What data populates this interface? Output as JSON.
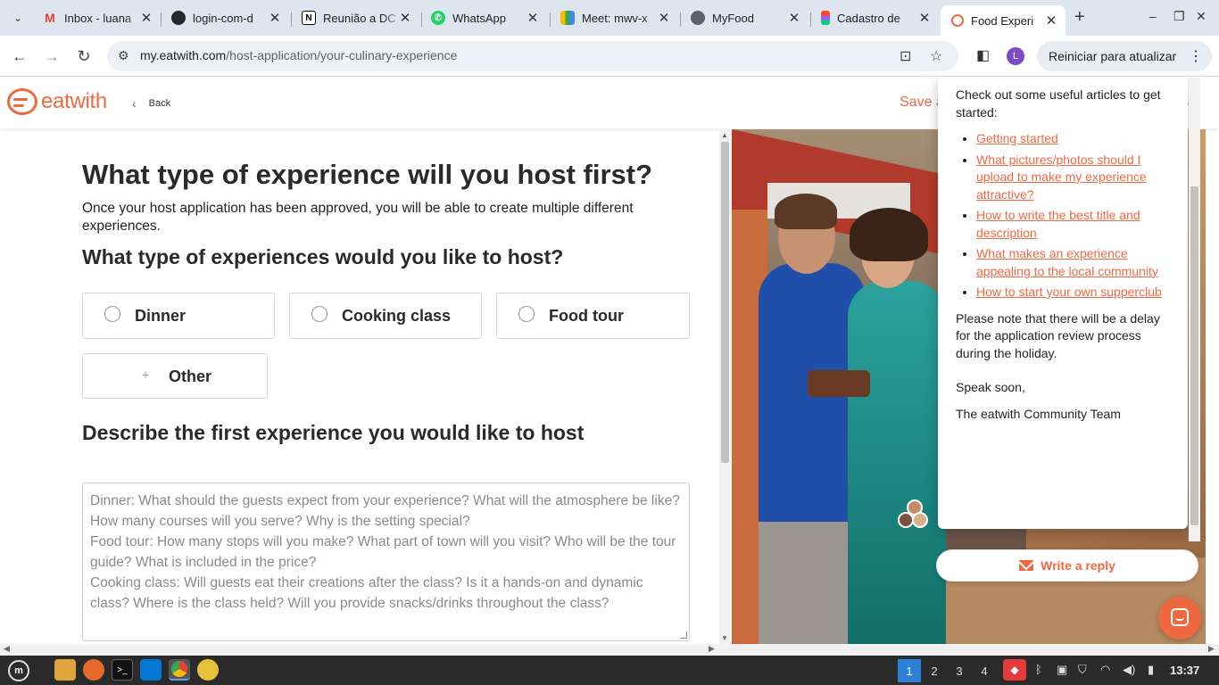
{
  "browser": {
    "tabs": [
      {
        "title": "Inbox - luana",
        "icon": "gmail-icon",
        "color": "#ea4335",
        "glyph": "M"
      },
      {
        "title": "login-com-d",
        "icon": "github-icon",
        "color": "#24292e",
        "glyph": "●"
      },
      {
        "title": "Reunião a DC",
        "icon": "notion-icon",
        "color": "#000000",
        "glyph": "N"
      },
      {
        "title": "WhatsApp",
        "icon": "whatsapp-icon",
        "color": "#25d366",
        "glyph": "✆"
      },
      {
        "title": "Meet: mwv-x",
        "icon": "meet-icon",
        "color": "#00897b",
        "glyph": "▶"
      },
      {
        "title": "MyFood",
        "icon": "globe-icon",
        "color": "#5f6368",
        "glyph": "◍"
      },
      {
        "title": "Cadastro de",
        "icon": "figma-icon",
        "color": "#a259ff",
        "glyph": "✦"
      },
      {
        "title": "Food Experi",
        "icon": "eatwith-icon",
        "color": "#ef6940",
        "glyph": "◉",
        "active": true
      }
    ],
    "url_domain": "my.eatwith.com",
    "url_path": "/host-application/your-culinary-experience",
    "update_button": "Reiniciar para atualizar",
    "profile_initial": "L"
  },
  "header": {
    "logo_text": "eatwith",
    "back_label": "Back",
    "save_label": "Save a",
    "right_letter": "D"
  },
  "form": {
    "title": "What type of experience will you host first?",
    "lead": "Once your host application has been approved, you will be able to create multiple different experiences.",
    "question": "What type of experiences would you like to host?",
    "options": [
      "Dinner",
      "Cooking class",
      "Food tour"
    ],
    "other_label": "Other",
    "other_plus": "+",
    "describe_heading": "Describe the first experience you would like to host",
    "textarea_placeholder": "Dinner: What should the guests expect from your experience? What will the atmosphere be like? How many courses will you serve? Why is the setting special?\nFood tour: How many stops will you make? What part of town will you visit? Who will be the tour guide? What is included in the price?\nCooking class: Will guests eat their creations after the class? Is it a hands-on and dynamic class? Where is the class held? Will you provide snacks/drinks throughout the class?"
  },
  "chat": {
    "intro": "Check out some useful articles to get started:",
    "links": [
      "Getting started",
      "What pictures/photos should I upload to make my experience attractive?",
      "How to write the best title and description",
      "What makes an experience appealing to the local community",
      "How to start your own supperclub"
    ],
    "note": "Please note that there will be a delay for the application review process during the holiday.",
    "signoff": "Speak soon,",
    "signature": "The eatwith Community Team",
    "reply_button": "Write a reply"
  },
  "taskbar": {
    "workspaces": [
      "1",
      "2",
      "3",
      "4"
    ],
    "active_workspace": "1",
    "clock": "13:37"
  },
  "colors": {
    "brand": "#ef6940",
    "tabbar": "#dfe5ee",
    "taskbar": "#2b2b2b"
  }
}
